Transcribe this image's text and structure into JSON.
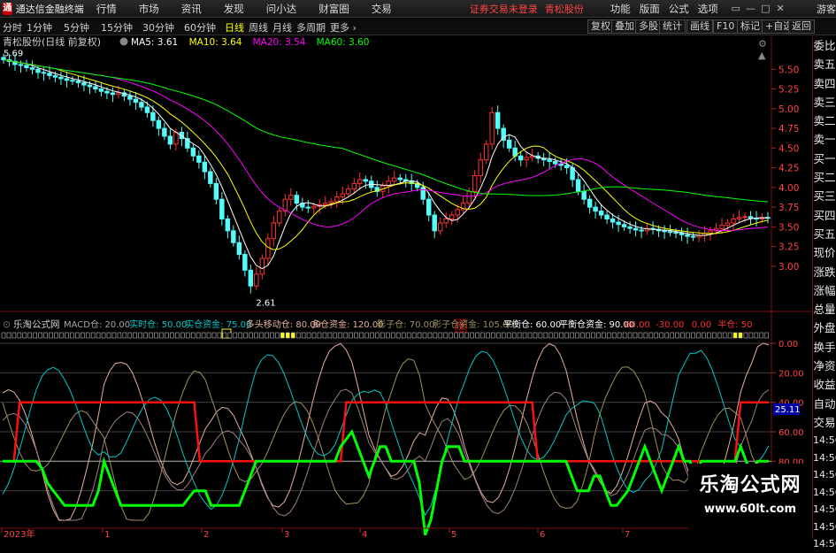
{
  "app": {
    "title": "通达信金融终端",
    "menus": [
      "行情",
      "市场",
      "资讯",
      "发现",
      "问小达",
      "财富圈",
      "交易"
    ],
    "notice": "证券交易未登录",
    "stock_name": "青松股份",
    "right_menus": [
      "功能",
      "版面",
      "公式",
      "选项"
    ],
    "guest": "游客",
    "window_buttons": [
      "▭",
      "—",
      "□",
      "✕"
    ]
  },
  "toolbar": {
    "periods": [
      "分时",
      "1分钟",
      "5分钟",
      "15分钟",
      "30分钟",
      "60分钟",
      "日线",
      "周线",
      "月线",
      "多周期",
      "更多 ›"
    ],
    "active_period": "日线",
    "buttons": [
      "复权",
      "叠加",
      "多股",
      "统计",
      "画线",
      "F10",
      "标记",
      "+自选",
      "返回"
    ]
  },
  "price_chart": {
    "title": "青松股份(日线 前复权)",
    "ma_labels": [
      {
        "text": "MA5: 3.61",
        "color": "#ffffff"
      },
      {
        "text": "MA10: 3.64",
        "color": "#ffff00"
      },
      {
        "text": "MA20: 3.54",
        "color": "#ff00ff"
      },
      {
        "text": "MA60: 3.60",
        "color": "#00ff00"
      }
    ],
    "high_label": "5.69",
    "low_label": "2.61",
    "badge": "涨",
    "price_ticks": [
      "5.50",
      "5.25",
      "5.00",
      "4.75",
      "4.50",
      "4.25",
      "4.00",
      "3.75",
      "3.50",
      "3.25",
      "3.00"
    ]
  },
  "indicator": {
    "title": "乐淘公式网",
    "params": [
      {
        "text": "MACD仓: 20.00",
        "color": "#a8a8a8"
      },
      {
        "text": "实时仓: 50.00",
        "color": "#00c8c8"
      },
      {
        "text": "实仓资金: 75.00",
        "color": "#00c8c8"
      },
      {
        "text": "多头移动仓: 80.00",
        "color": "#e8b0a0"
      },
      {
        "text": "多仓资金: 120.00",
        "color": "#e8b0a0"
      },
      {
        "text": "影子仓: 70.00",
        "color": "#a09060"
      },
      {
        "text": "影子仓资金: 105.00",
        "color": "#a09060"
      },
      {
        "text": "平衡仓: 60.00",
        "color": "#ffffff"
      },
      {
        "text": "平衡仓资金: 90.00",
        "color": "#ffffff"
      },
      {
        "text": "60.00",
        "color": "#ff3030"
      },
      {
        "text": "-30.00",
        "color": "#ff3030"
      },
      {
        "text": "0.00",
        "color": "#ff3030"
      },
      {
        "text": "半仓: 50",
        "color": "#ff3030"
      }
    ],
    "ticks": [
      "100.0",
      "80.00",
      "60.00",
      "40.00",
      "20.00",
      "0.00"
    ],
    "current_value": "25.11"
  },
  "time_axis": {
    "labels": [
      "2023年",
      "1",
      "2",
      "3",
      "4",
      "5",
      "6",
      "7"
    ]
  },
  "sidebar": {
    "items": [
      "委比",
      "卖五",
      "卖四",
      "卖三",
      "卖二",
      "卖一",
      "买一",
      "买二",
      "买三",
      "买四",
      "买五",
      "现价",
      "涨跌",
      "涨幅",
      "总量",
      "外盘",
      "换手",
      "净资",
      "收益",
      "自动",
      "交易",
      "14:56",
      "14:56",
      "14:56",
      "14:56",
      "14:56",
      "14:56",
      "14:56"
    ]
  },
  "watermark": {
    "line1": "乐淘公式网",
    "line2": "www.60lt.com"
  },
  "chart_data": [
    {
      "type": "candlestick",
      "title": "青松股份(日线 前复权)",
      "x_labels": [
        "2023年",
        "1",
        "2",
        "3",
        "4",
        "5",
        "6",
        "7"
      ],
      "ylim": [
        2.55,
        5.75
      ],
      "annotations": [
        {
          "text": "5.69",
          "value": 5.69
        },
        {
          "text": "2.61",
          "value": 2.61
        }
      ],
      "close": [
        5.62,
        5.6,
        5.56,
        5.55,
        5.52,
        5.5,
        5.46,
        5.45,
        5.42,
        5.4,
        5.38,
        5.36,
        5.35,
        5.33,
        5.3,
        5.28,
        5.25,
        5.22,
        5.2,
        5.18,
        5.2,
        5.16,
        5.12,
        5.08,
        5.02,
        4.95,
        4.85,
        4.75,
        4.65,
        4.55,
        4.7,
        4.62,
        4.5,
        4.4,
        4.32,
        4.2,
        4.05,
        3.85,
        3.6,
        3.45,
        3.3,
        3.15,
        2.95,
        2.75,
        2.9,
        3.1,
        3.35,
        3.55,
        3.7,
        3.85,
        3.9,
        3.8,
        3.75,
        3.74,
        3.76,
        3.78,
        3.8,
        3.82,
        3.88,
        3.92,
        3.98,
        4.05,
        4.1,
        4.08,
        4.0,
        3.95,
        4.02,
        4.08,
        4.12,
        4.1,
        4.08,
        4.05,
        4.0,
        3.85,
        3.65,
        3.45,
        3.55,
        3.6,
        3.65,
        3.72,
        3.8,
        3.95,
        4.15,
        4.35,
        4.55,
        4.95,
        4.75,
        4.6,
        4.5,
        4.4,
        4.35,
        4.38,
        4.4,
        4.37,
        4.35,
        4.33,
        4.3,
        4.28,
        4.25,
        4.1,
        3.95,
        3.85,
        3.75,
        3.7,
        3.65,
        3.6,
        3.56,
        3.53,
        3.5,
        3.48,
        3.46,
        3.45,
        3.48,
        3.47,
        3.45,
        3.44,
        3.43,
        3.42,
        3.4,
        3.38,
        3.37,
        3.39,
        3.42,
        3.45,
        3.48,
        3.52,
        3.55,
        3.6,
        3.62,
        3.63,
        3.61,
        3.6,
        3.62,
        3.61
      ],
      "series": [
        {
          "name": "MA5",
          "color": "#ffffff",
          "last": 3.61
        },
        {
          "name": "MA10",
          "color": "#ffff00",
          "last": 3.64
        },
        {
          "name": "MA20",
          "color": "#ff00ff",
          "last": 3.54
        },
        {
          "name": "MA60",
          "color": "#00ff00",
          "last": 3.6
        }
      ]
    },
    {
      "type": "line",
      "title": "乐淘公式网",
      "ylim": [
        -20,
        100
      ],
      "ticks": [
        0,
        20,
        40,
        60,
        80,
        100
      ],
      "series": [
        {
          "name": "MACD仓",
          "color": "#00ff00",
          "values": [
            20,
            20,
            20,
            20,
            20,
            20,
            20,
            15,
            5,
            0,
            -5,
            -10,
            -10,
            -10,
            -10,
            -10,
            -10,
            0,
            20,
            10,
            0,
            -10,
            -10,
            -10,
            -10,
            -10,
            -10,
            -10,
            -10,
            -10,
            -10,
            -10,
            -10,
            -5,
            0,
            0,
            0,
            -10,
            -10,
            -10,
            -10,
            -10,
            -10,
            0,
            10,
            20,
            20,
            20,
            20,
            20,
            20,
            20,
            20,
            20,
            20,
            20,
            20,
            20,
            20,
            20,
            30,
            35,
            40,
            30,
            20,
            10,
            20,
            30,
            30,
            20,
            20,
            20,
            20,
            20,
            5,
            -30,
            -20,
            0,
            20,
            30,
            30,
            30,
            20,
            20,
            20,
            20,
            20,
            20,
            20,
            20,
            20,
            20,
            20,
            20,
            20,
            20,
            20,
            20,
            20,
            20,
            20,
            10,
            0,
            0,
            0,
            10,
            10,
            0,
            -10,
            -10,
            -5,
            0,
            10,
            20,
            30,
            20,
            10,
            0,
            10,
            20,
            30,
            20,
            20,
            10,
            20,
            20,
            20,
            20,
            20,
            20,
            20,
            30,
            20,
            10,
            20,
            20,
            20
          ]
        },
        {
          "name": "实时仓",
          "color": "#00c8c8",
          "last": 50
        },
        {
          "name": "多头移动仓",
          "color": "#e8b0a0",
          "last": 80
        },
        {
          "name": "影子仓",
          "color": "#a09060",
          "last": 70
        },
        {
          "name": "平衡仓",
          "color": "#ffffff",
          "last": 60
        },
        {
          "name": "半仓",
          "color": "#ff3030",
          "last": 50
        }
      ]
    }
  ]
}
